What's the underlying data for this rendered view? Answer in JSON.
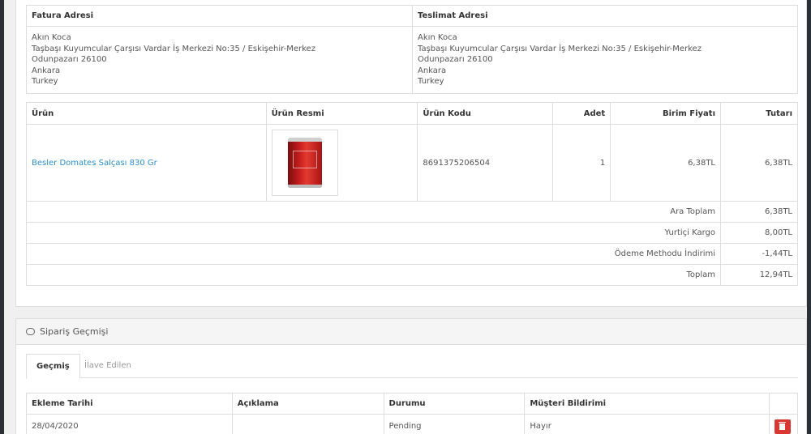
{
  "address": {
    "billing_header": "Fatura Adresi",
    "shipping_header": "Teslimat Adresi",
    "billing_lines": [
      "Akın Koca",
      "Taşbaşı Kuyumcular Çarşısı Vardar İş Merkezi No:35 / Eskişehir-Merkez",
      "Odunpazarı 26100",
      "Ankara",
      "Turkey"
    ],
    "shipping_lines": [
      "Akın Koca",
      "Taşbaşı Kuyumcular Çarşısı Vardar İş Merkezi No:35 / Eskişehir-Merkez",
      "Odunpazarı 26100",
      "Ankara",
      "Turkey"
    ]
  },
  "products": {
    "headers": {
      "product": "Ürün",
      "image": "Ürün Resmi",
      "code": "Ürün Kodu",
      "qty": "Adet",
      "unit_price": "Birim Fiyatı",
      "total": "Tutarı"
    },
    "item": {
      "name": "Besler Domates Salçası 830 Gr",
      "code": "8691375206504",
      "qty": "1",
      "unit_price": "6,38TL",
      "total": "6,38TL"
    },
    "summary": [
      {
        "label": "Ara Toplam",
        "value": "6,38TL"
      },
      {
        "label": "Yurtiçi Kargo",
        "value": "8,00TL"
      },
      {
        "label": "Ödeme Methodu İndirimi",
        "value": "-1,44TL"
      },
      {
        "label": "Toplam",
        "value": "12,94TL"
      }
    ]
  },
  "history": {
    "title": "Sipariş Geçmişi",
    "tabs": [
      "Geçmiş",
      "İlave Edilen"
    ],
    "headers": {
      "date": "Ekleme Tarihi",
      "comment": "Açıklama",
      "status": "Durumu",
      "notify": "Müşteri Bildirimi"
    },
    "rows": [
      {
        "date": "28/04/2020",
        "comment": "",
        "status": "Pending",
        "notify": "Hayır"
      }
    ]
  },
  "colors": {
    "link": "#2a8fd1",
    "delete_button": "#d9372f"
  }
}
